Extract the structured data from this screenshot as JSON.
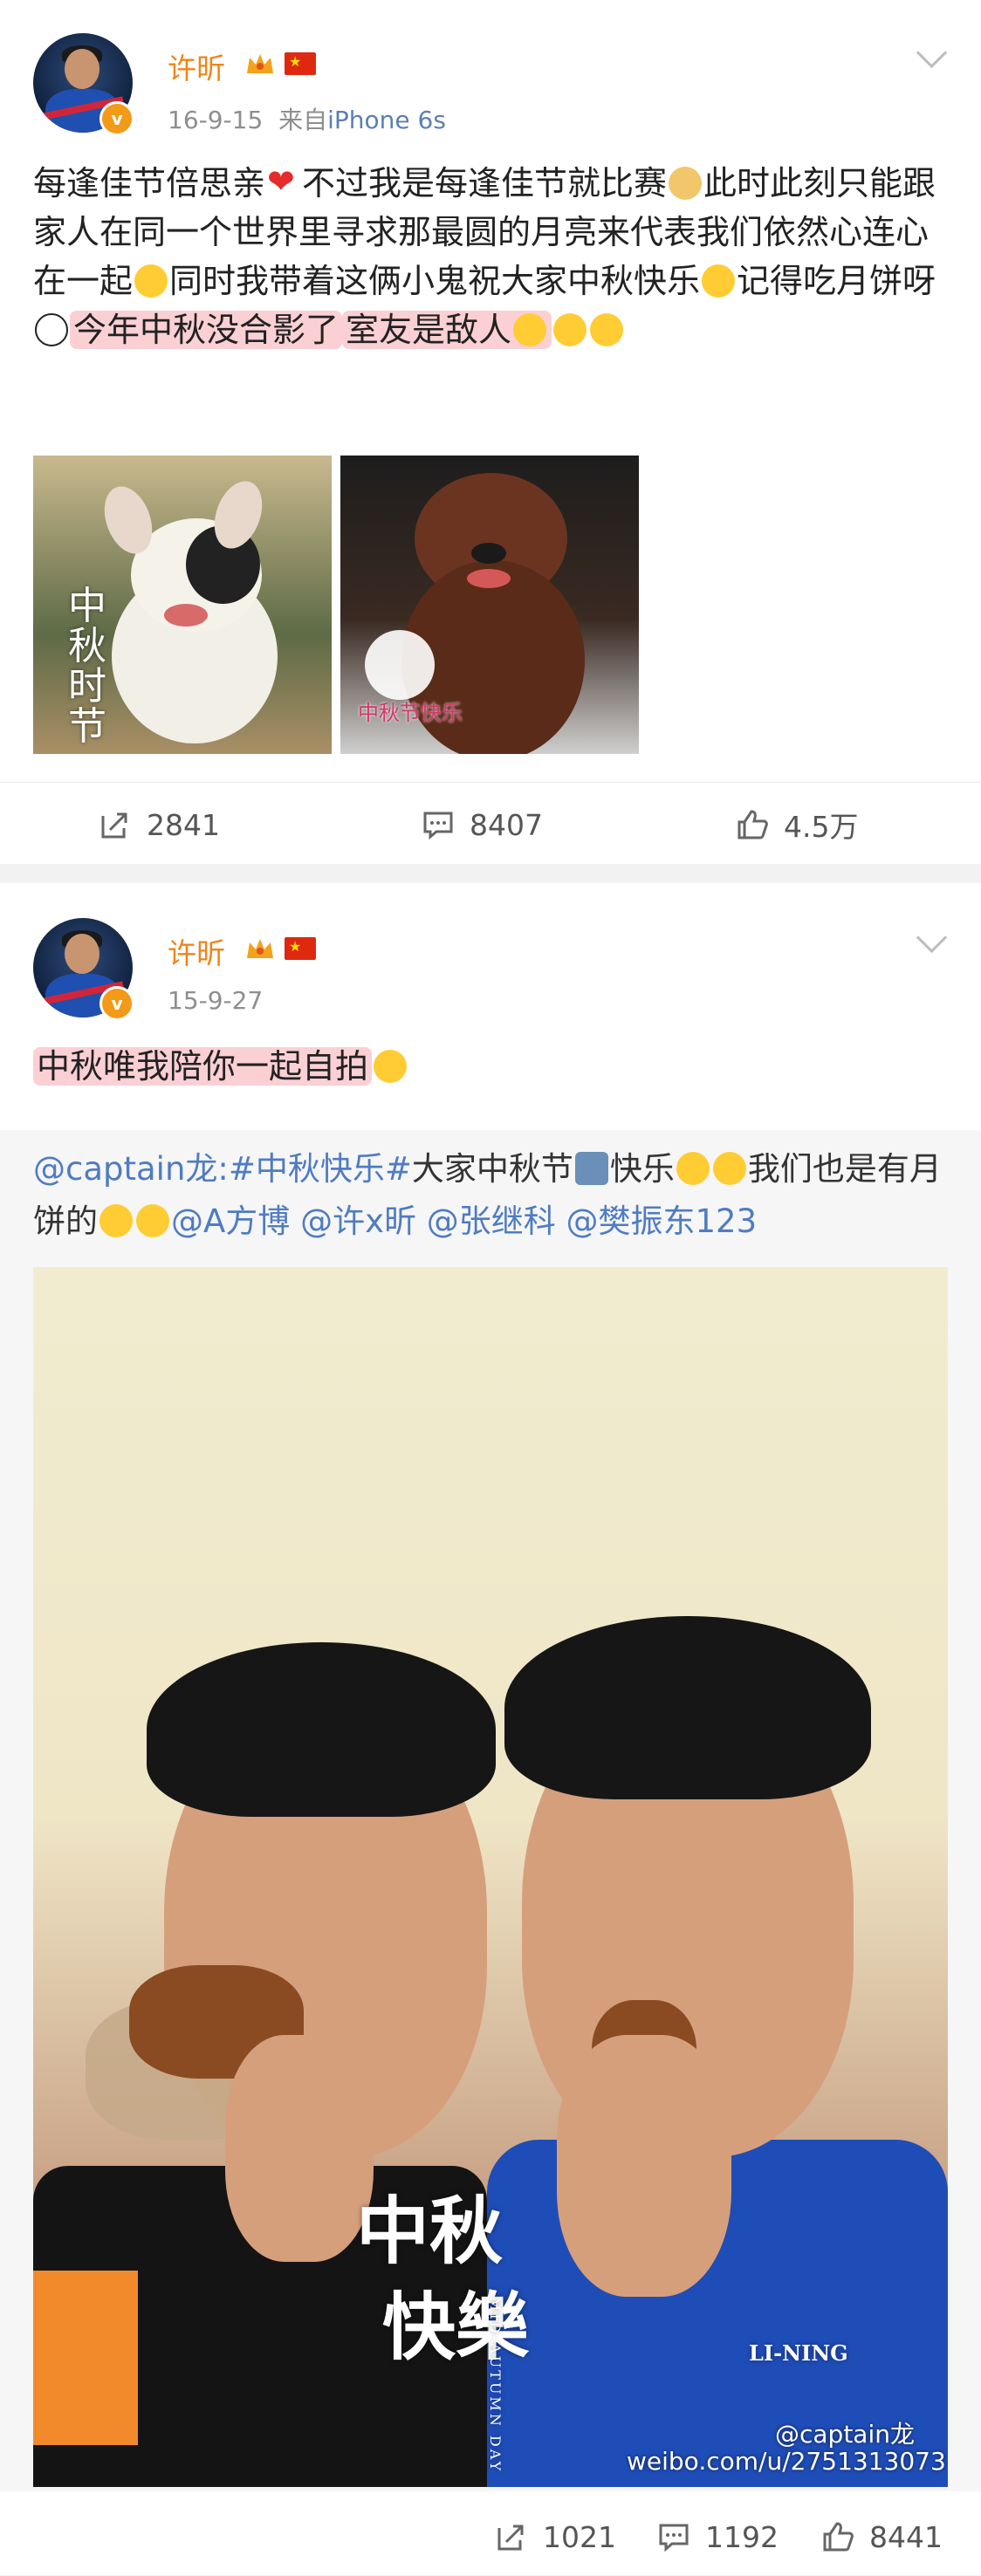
{
  "post1": {
    "username": "许昕",
    "date": "16-9-15",
    "source_prefix": "来自",
    "source_device": "iPhone 6s",
    "text_segments": {
      "s1": "每逢佳节倍思亲",
      "s2": "不过我是每逢佳节就比赛",
      "s3": "此时此刻只能跟家人在同一个世界里寻求那最圆的月亮来代表我们依然心连心在一起",
      "s4": "同时我带着这俩小鬼祝大家中秋快乐",
      "s5": "记得吃月饼呀",
      "hl1": "今年中秋没合影了",
      "hl2": "室友是敌人"
    },
    "image1_stamp": "中秋 时节",
    "image2_stamp": "中秋节快乐",
    "actions": {
      "repost": "2841",
      "comment": "8407",
      "like": "4.5万"
    }
  },
  "post2": {
    "username": "许昕",
    "date": "15-9-27",
    "text": "中秋唯我陪你一起自拍",
    "repost": {
      "author": "@captain龙",
      "hashtag": ":#中秋快乐#",
      "t1": "大家中秋节",
      "t2": "快乐",
      "t3": "我们也是有月饼的",
      "mentions": [
        "@A方博",
        "@许x昕",
        "@张继科",
        "@樊振东123"
      ]
    },
    "image_text": {
      "title1": "中秋",
      "title2": "快樂",
      "sub": "MID-AUTUMN DAY",
      "shirt_brand": "LI-NING"
    },
    "watermark": {
      "handle": "@captain龙",
      "url": "weibo.com/u/2751313073"
    },
    "actions": {
      "repost": "1021",
      "comment": "1192",
      "like": "8441"
    }
  },
  "colors": {
    "username": "#f08418",
    "link": "#4f7cc2",
    "highlight": "#fbd0d4",
    "vip": "#f39a18"
  }
}
